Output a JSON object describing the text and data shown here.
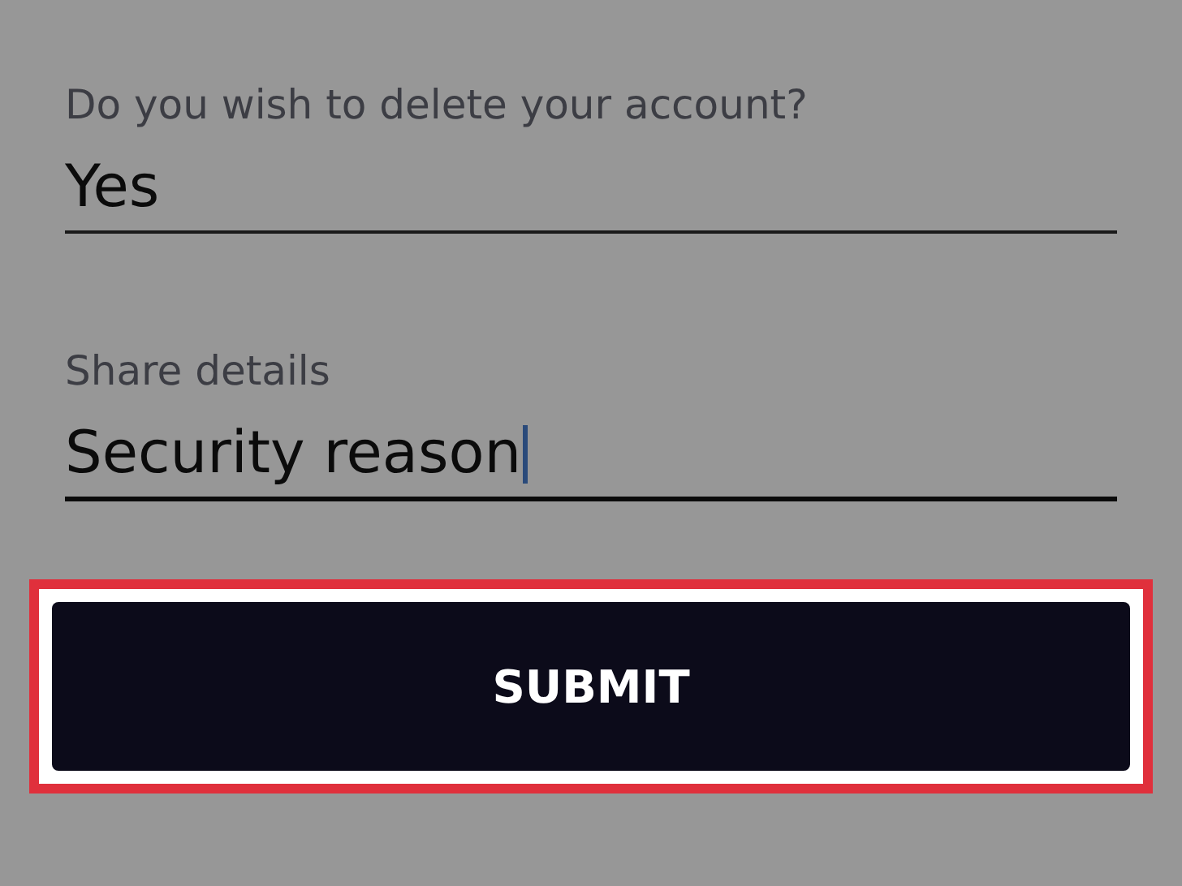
{
  "fields": [
    {
      "label": "Do you wish to delete your account?",
      "value": "Yes",
      "focused": false
    },
    {
      "label": "Share details",
      "value": "Security reason",
      "focused": true
    }
  ],
  "submit": {
    "label": "SUBMIT",
    "highlighted": true
  }
}
